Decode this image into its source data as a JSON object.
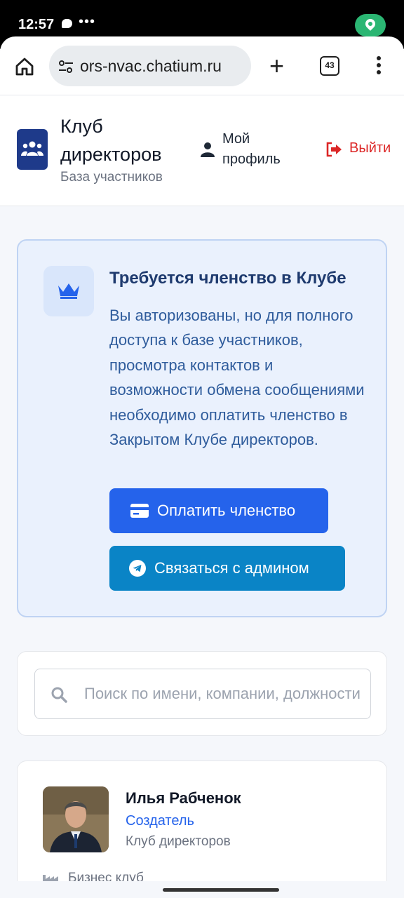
{
  "status_bar": {
    "time": "12:57",
    "more": "•••"
  },
  "browser": {
    "url": "ors-nvac.chatium.ru",
    "tab_count": "43"
  },
  "header": {
    "title": "Клуб директоров",
    "subtitle": "База участников",
    "profile_label": "Мой профиль",
    "logout_label": "Выйти"
  },
  "membership": {
    "title": "Требуется членство в Клубе",
    "text": "Вы авторизованы, но для полного доступа к базе участников, просмотра контактов и возможности обмена сообщениями необходимо оплатить членство в Закрытом Клубе директоров.",
    "pay_button": "Оплатить членство",
    "contact_button": "Связаться с админом"
  },
  "search": {
    "placeholder": "Поиск по имени, компании, должности"
  },
  "members": [
    {
      "name": "Илья Рабченок",
      "role": "Создатель",
      "org": "Клуб директоров",
      "company": "Бизнес клуб"
    }
  ],
  "colors": {
    "accent": "#2563eb",
    "telegram": "#0a84c6",
    "logout": "#dc2626",
    "brand": "#1e3a8a"
  }
}
